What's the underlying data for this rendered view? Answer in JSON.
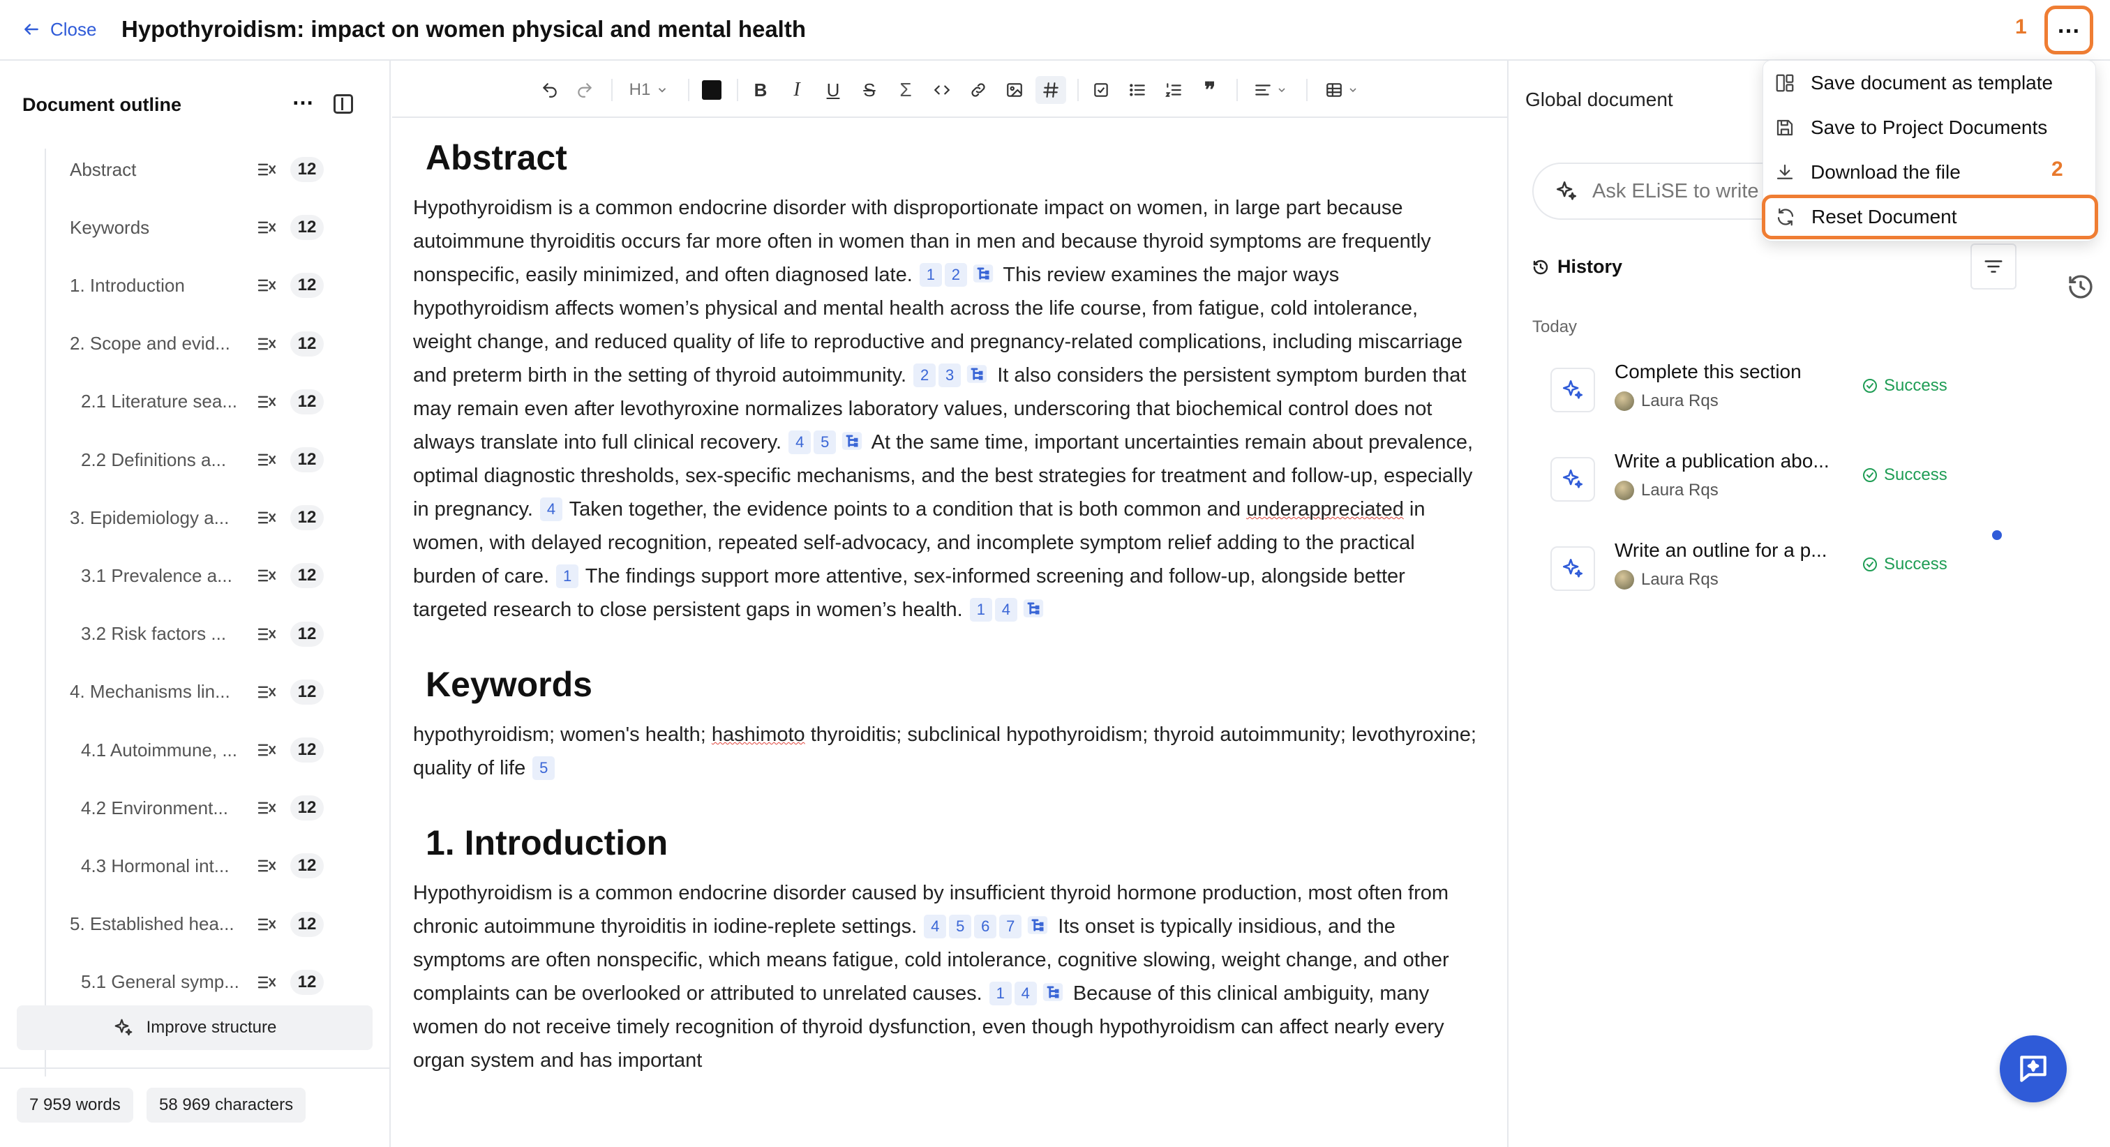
{
  "header": {
    "close_label": "Close",
    "title": "Hypothyroidism: impact on women physical and mental health",
    "marker_1": "1",
    "marker_2": "2",
    "more_icon": "more-horizontal-icon"
  },
  "menu": {
    "items": [
      {
        "label": "Save document as template",
        "icon": "template-icon"
      },
      {
        "label": "Save to Project Documents",
        "icon": "save-icon"
      },
      {
        "label": "Download the file",
        "icon": "download-icon"
      },
      {
        "label": "Reset Document",
        "icon": "reset-icon"
      }
    ]
  },
  "outline": {
    "title": "Document outline",
    "items": [
      {
        "label": "Abstract",
        "count": "12"
      },
      {
        "label": "Keywords",
        "count": "12"
      },
      {
        "label": "1. Introduction",
        "count": "12"
      },
      {
        "label": "2. Scope and evid...",
        "count": "12"
      },
      {
        "label": "2.1 Literature sea...",
        "count": "12"
      },
      {
        "label": "2.2 Definitions a...",
        "count": "12"
      },
      {
        "label": "3. Epidemiology a...",
        "count": "12"
      },
      {
        "label": "3.1 Prevalence a...",
        "count": "12"
      },
      {
        "label": "3.2 Risk factors ...",
        "count": "12"
      },
      {
        "label": "4. Mechanisms lin...",
        "count": "12"
      },
      {
        "label": "4.1 Autoimmune, ...",
        "count": "12"
      },
      {
        "label": "4.2 Environment...",
        "count": "12"
      },
      {
        "label": "4.3 Hormonal int...",
        "count": "12"
      },
      {
        "label": "5. Established hea...",
        "count": "12"
      },
      {
        "label": "5.1 General symp...",
        "count": "12"
      }
    ],
    "improve_label": "Improve structure",
    "words": "7 959 words",
    "characters": "58 969 characters"
  },
  "toolbar": {
    "heading": "H1",
    "text_color": "#111111"
  },
  "document": {
    "abstract": {
      "heading": "Abstract",
      "p1": " Hypothyroidism is a common endocrine disorder with disproportionate impact on women, in large part because autoimmune thyroiditis occurs far more often in women than in men and because thyroid symptoms are frequently nonspecific, easily minimized, and often diagnosed late.",
      "c1": [
        "1",
        "2"
      ],
      "p2": "This review examines the major ways hypothyroidism affects women’s physical and mental health across the life course, from fatigue, cold intolerance, weight change, and reduced quality of life to reproductive and pregnancy-related complications, including miscarriage and preterm birth in the setting of thyroid autoimmunity.",
      "c2": [
        "2",
        "3"
      ],
      "p3": "It also considers the persistent symptom burden that may remain even after levothyroxine normalizes laboratory values, underscoring that biochemical control does not always translate into full clinical recovery.",
      "c3": [
        "4",
        "5"
      ],
      "p4": "At the same time, important uncertainties remain about prevalence, optimal diagnostic thresholds, sex-specific mechanisms, and the best strategies for treatment and follow-up, especially in pregnancy.",
      "c4": [
        "4"
      ],
      "p5a": "Taken together, the evidence points to a condition that is both common and ",
      "p5b": "underappreciated",
      "p5c": " in women, with delayed recognition, repeated self-advocacy, and incomplete symptom relief adding to the practical burden of care.",
      "c5": [
        "1"
      ],
      "p6": "The findings support more attentive, sex-informed screening and follow-up, alongside better targeted research to close persistent gaps in women’s health.",
      "c6": [
        "1",
        "4"
      ]
    },
    "keywords": {
      "heading": "Keywords",
      "p1a": " hypothyroidism; women's health; ",
      "p1b": "hashimoto",
      "p1c": " thyroiditis; subclinical hypothyroidism; thyroid autoimmunity; levothyroxine; quality of life",
      "c1": [
        "5"
      ]
    },
    "introduction": {
      "heading": "1. Introduction",
      "p1": " Hypothyroidism is a common endocrine disorder caused by insufficient thyroid hormone production, most often from chronic autoimmune thyroiditis in iodine-replete settings.",
      "c1": [
        "4",
        "5",
        "6",
        "7"
      ],
      "p2": "Its onset is typically insidious, and the symptoms are often nonspecific, which means fatigue, cold intolerance, cognitive slowing, weight change, and other complaints can be overlooked or attributed to unrelated causes.",
      "c2": [
        "1",
        "4"
      ],
      "p3": "Because of this clinical ambiguity, many women do not receive timely recognition of thyroid dysfunction, even though hypothyroidism can affect nearly every organ system and has important"
    }
  },
  "right_panel": {
    "title": "Global document",
    "ask_placeholder": "Ask ELiSE to write",
    "history_title": "History",
    "today_label": "Today",
    "history": [
      {
        "title": "Complete this section",
        "author": "Laura Rqs",
        "status": "Success"
      },
      {
        "title": "Write a publication abo...",
        "author": "Laura Rqs",
        "status": "Success"
      },
      {
        "title": "Write an outline for a p...",
        "author": "Laura Rqs",
        "status": "Success"
      }
    ]
  },
  "colors": {
    "accent": "#2f5bd8",
    "highlight": "#ef7d33",
    "success": "#1f9d55"
  }
}
